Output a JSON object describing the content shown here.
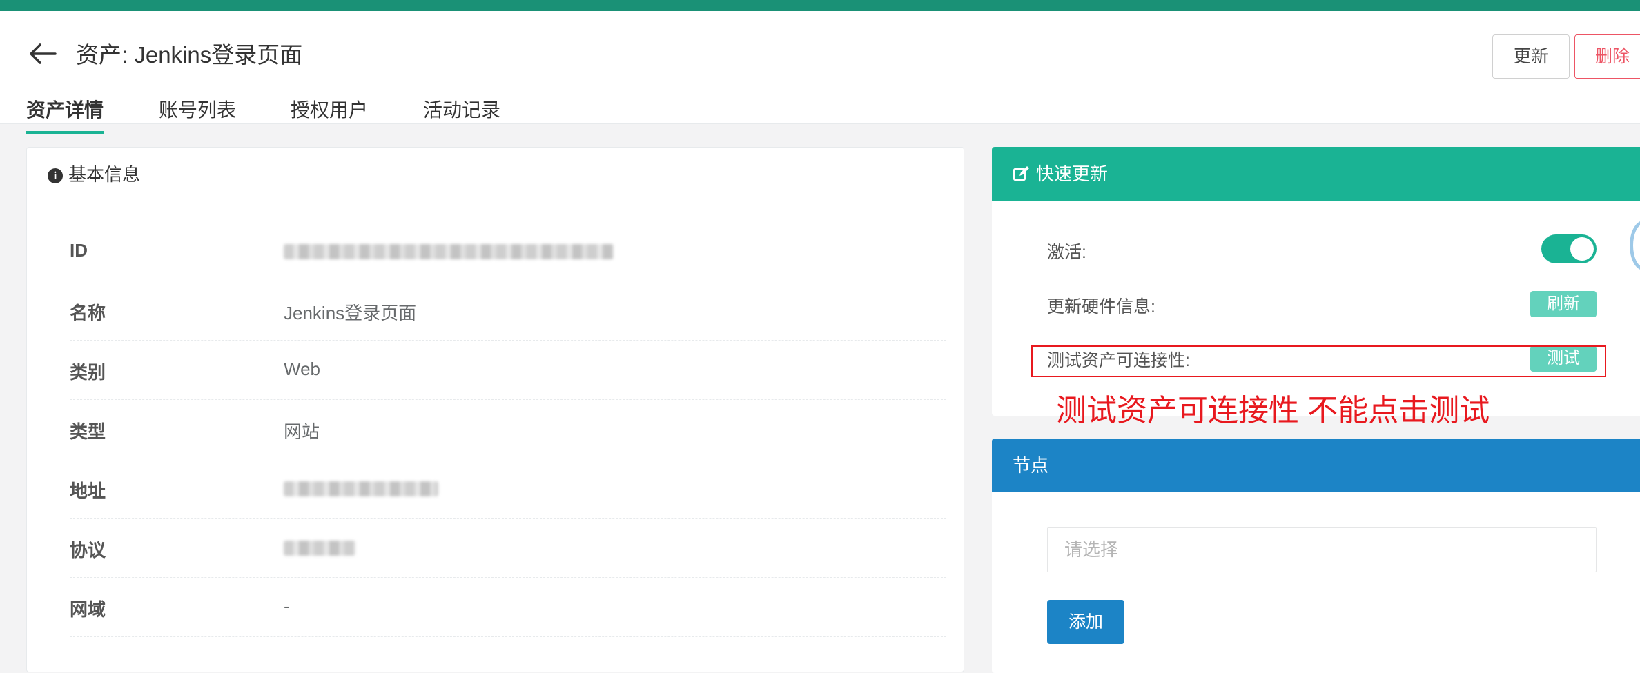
{
  "header": {
    "title": "资产: Jenkins登录页面",
    "update_label": "更新",
    "delete_label": "删除"
  },
  "tabs": [
    {
      "label": "资产详情",
      "active": true
    },
    {
      "label": "账号列表",
      "active": false
    },
    {
      "label": "授权用户",
      "active": false
    },
    {
      "label": "活动记录",
      "active": false
    }
  ],
  "basic_info": {
    "title": "基本信息",
    "rows": [
      {
        "label": "ID",
        "value": ""
      },
      {
        "label": "名称",
        "value": "Jenkins登录页面"
      },
      {
        "label": "类别",
        "value": "Web"
      },
      {
        "label": "类型",
        "value": "网站"
      },
      {
        "label": "地址",
        "value": ""
      },
      {
        "label": "协议",
        "value": ""
      },
      {
        "label": "网域",
        "value": "-"
      }
    ]
  },
  "quick_update": {
    "title": "快速更新",
    "active_label": "激活:",
    "active_on": true,
    "hardware_label": "更新硬件信息:",
    "refresh_label": "刷新",
    "connectivity_label": "测试资产可连接性:",
    "test_label": "测试"
  },
  "annotation": {
    "text": "测试资产可连接性  不能点击测试",
    "color": "#e8191f"
  },
  "nodes": {
    "title": "节点",
    "placeholder": "请选择",
    "add_label": "添加"
  },
  "colors": {
    "topbar": "#1a9176",
    "primary": "#1ab394",
    "info": "#1c84c6",
    "danger": "#ed5565"
  }
}
